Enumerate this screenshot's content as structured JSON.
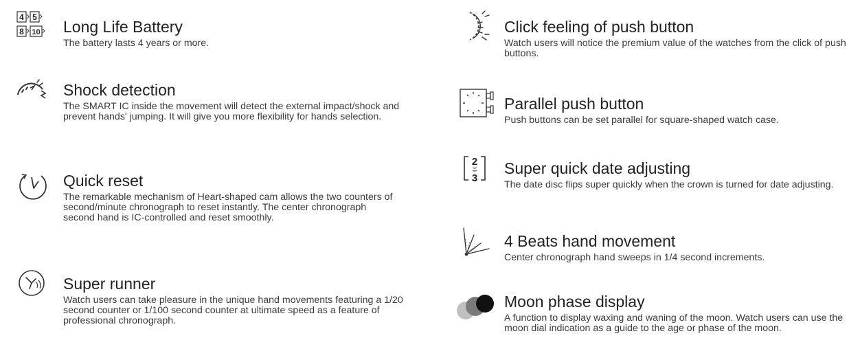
{
  "left": [
    {
      "title": "Long Life Battery",
      "desc": "The battery lasts 4 years or more.",
      "icon": "battery-years-icon",
      "badges": [
        "4",
        "5",
        "8",
        "10"
      ]
    },
    {
      "title": "Shock detection",
      "desc": "The SMART IC inside the movement will detect the external impact/shock and prevent hands' jumping. It will give you more flexibility for hands selection.",
      "icon": "shock-icon"
    },
    {
      "title": "Quick reset",
      "desc": "The remarkable mechanism of Heart-shaped cam allows the two counters of second/minute chronograph to reset instantly. The center chronograph second hand is IC-controlled and reset smoothly.",
      "icon": "reset-icon"
    },
    {
      "title": "Super runner",
      "desc": "Watch users can take pleasure in the unique hand movements featuring a 1/20 second counter or 1/100 second counter at ultimate speed as a feature of professional chronograph.",
      "icon": "runner-icon"
    }
  ],
  "right": [
    {
      "title": "Click feeling of push button",
      "desc": "Watch users will notice the premium value of the watches from the click of push buttons.",
      "icon": "click-icon"
    },
    {
      "title": "Parallel push button",
      "desc": "Push buttons can be set parallel for square-shaped watch case.",
      "icon": "parallel-button-icon"
    },
    {
      "title": "Super quick date adjusting",
      "desc": "The date disc flips super quickly when the crown is turned for date adjusting.",
      "icon": "date-adjust-icon",
      "digits": [
        "2",
        "3"
      ]
    },
    {
      "title": "4 Beats hand movement",
      "desc": "Center chronograph hand sweeps in 1/4 second increments.",
      "icon": "beats-icon"
    },
    {
      "title": "Moon phase display",
      "desc": "A function to display waxing and waning of the moon. Watch users can use the moon dial indication as a guide to the age or phase of the moon.",
      "icon": "moon-icon"
    }
  ]
}
